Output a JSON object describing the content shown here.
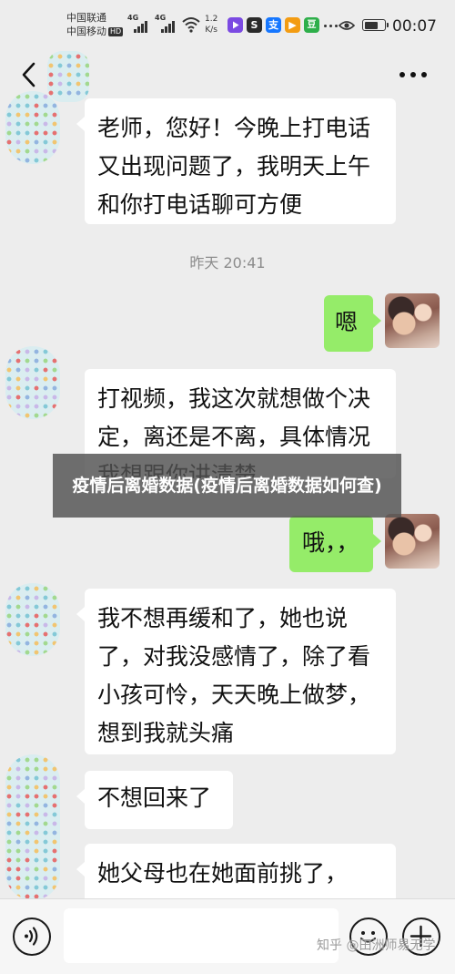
{
  "status_bar": {
    "carrier_line1": "中国联通",
    "carrier_line2": "中国移动",
    "hd_badge": "HD",
    "net_type_1": "4G",
    "net_type_2": "4G",
    "speed_value": "1.2",
    "speed_unit": "K/s",
    "app_icons": [
      {
        "name": "video-app-icon",
        "glyph": "",
        "color": "#7b4ae2"
      },
      {
        "name": "soul-app-icon",
        "glyph": "S",
        "color": "#2a2a2a"
      },
      {
        "name": "alipay-icon",
        "glyph": "支",
        "color": "#1677ff"
      },
      {
        "name": "media-app-icon",
        "glyph": "▶",
        "color": "#f39c12"
      },
      {
        "name": "dou-app-icon",
        "glyph": "豆",
        "color": "#2eaf4a"
      }
    ],
    "battery_level": 0.72,
    "time": "00:07"
  },
  "messages": {
    "m1": "老师，您好！今晚上打电话又出现问题了，我明天上午和你打电话聊可方便",
    "time1": "昨天 20:41",
    "m2": "嗯",
    "m3": "打视频，我这次就想做个决定，离还是不离，具体情况我想跟你讲清楚",
    "m4": "哦，，",
    "m5": "我不想再缓和了，她也说了，对我没感情了，除了看小孩可怜，天天晚上做梦，想到我就头痛",
    "m6": "不想回来了",
    "m7": "她父母也在她面前挑了，"
  },
  "banner": {
    "title": "疫情后离婚数据(疫情后离婚数据如何查)"
  },
  "watermark": "知乎 @田洲师易无学",
  "colors": {
    "background": "#ededed",
    "incoming_bubble": "#ffffff",
    "outgoing_bubble": "#95ec69",
    "timestamp_text": "#8c8c8c"
  }
}
